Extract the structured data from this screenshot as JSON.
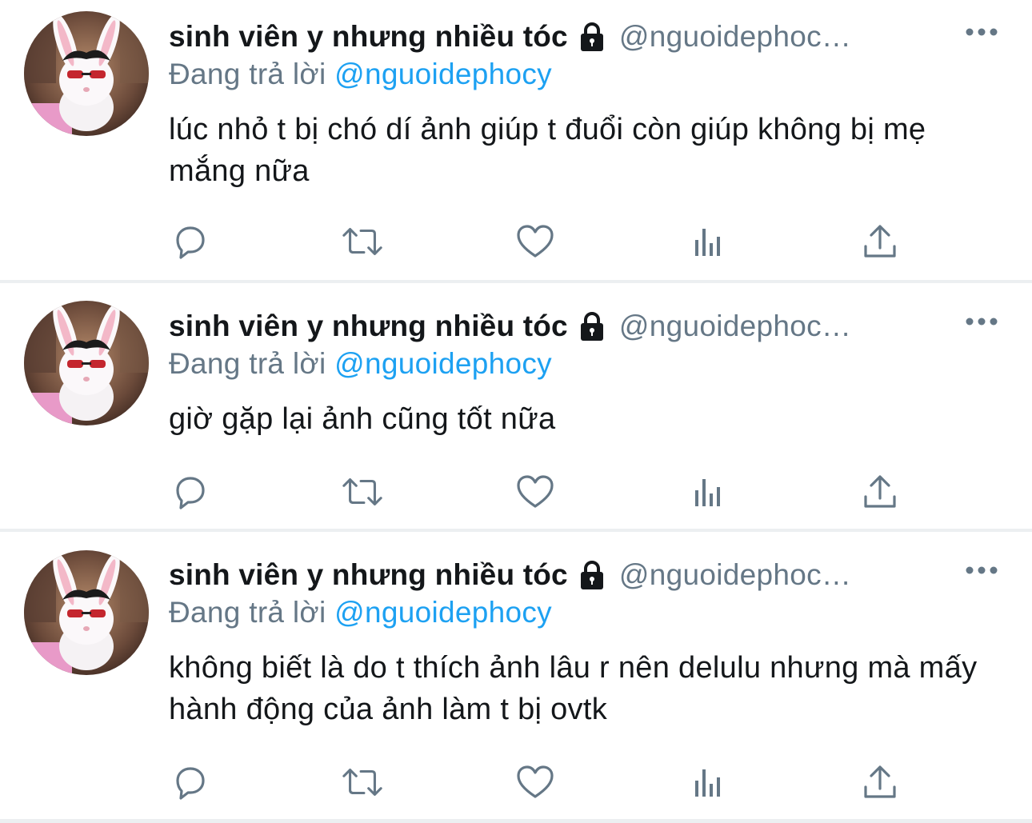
{
  "tweets": [
    {
      "author": {
        "display_name": "sinh viên y nhưng nhiều tóc",
        "handle": "@nguoidephoc…",
        "locked_icon": "lock-icon",
        "avatar_icon": "avatar-bunny-sunglasses"
      },
      "reply_label": "Đang trả lời",
      "reply_to": "@nguoidephocy",
      "text": "lúc nhỏ t bị chó dí ảnh giúp t đuổi còn giúp không bị mẹ mắng nữa"
    },
    {
      "author": {
        "display_name": "sinh viên y nhưng nhiều tóc",
        "handle": "@nguoidephoc…",
        "locked_icon": "lock-icon",
        "avatar_icon": "avatar-bunny-sunglasses"
      },
      "reply_label": "Đang trả lời",
      "reply_to": "@nguoidephocy",
      "text": "giờ gặp lại ảnh cũng tốt nữa"
    },
    {
      "author": {
        "display_name": "sinh viên y nhưng nhiều tóc",
        "handle": "@nguoidephoc…",
        "locked_icon": "lock-icon",
        "avatar_icon": "avatar-bunny-sunglasses"
      },
      "reply_label": "Đang trả lời",
      "reply_to": "@nguoidephocy",
      "text": "không biết là do t thích ảnh lâu r nên delulu nhưng mà mấy hành động của ảnh làm t bị ovtk"
    }
  ],
  "actions": [
    "reply-icon",
    "retweet-icon",
    "like-icon",
    "views-icon",
    "share-icon"
  ],
  "more_icon": "more-horizontal-icon",
  "colors": {
    "text_primary": "#14171a",
    "text_secondary": "#657786",
    "link": "#1da1f2",
    "icon": "#657786",
    "divider": "#eceff1"
  }
}
